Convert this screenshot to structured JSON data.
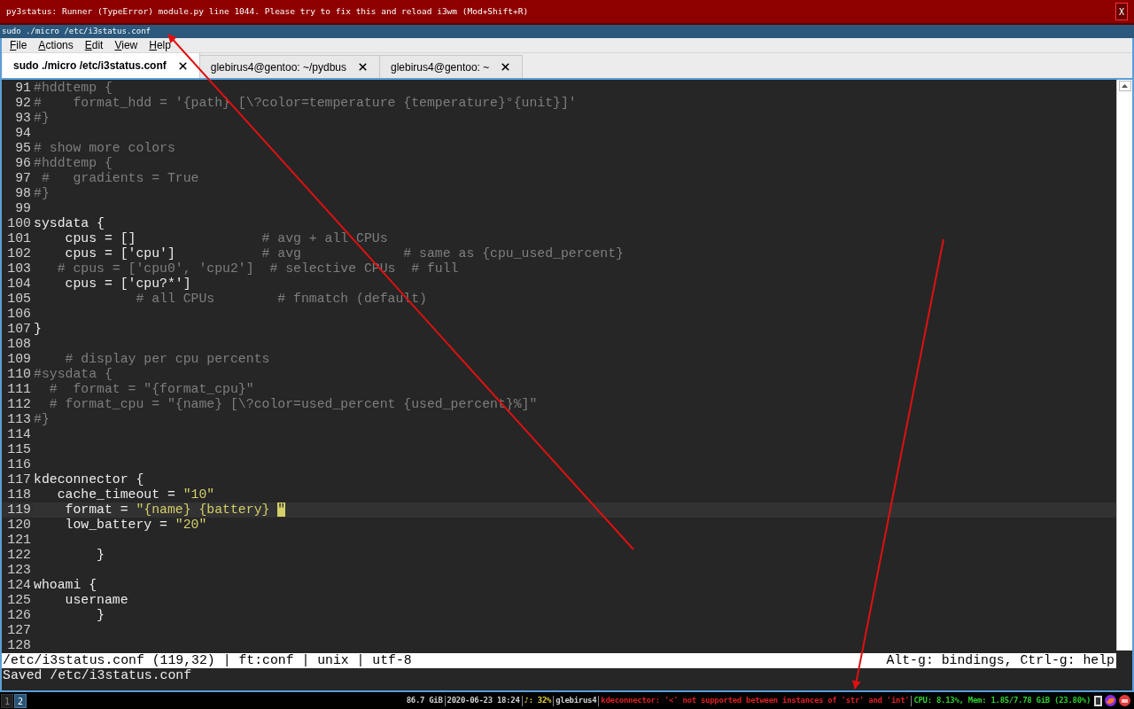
{
  "notification": {
    "message": "py3status: Runner (TypeError) module.py line 1044. Please try to fix this and reload i3wm (Mod+Shift+R)",
    "close": "X"
  },
  "window": {
    "title": "sudo ./micro /etc/i3status.conf"
  },
  "menu": [
    "File",
    "Actions",
    "Edit",
    "View",
    "Help"
  ],
  "tabs": [
    {
      "label": "sudo ./micro /etc/i3status.conf",
      "selected": true
    },
    {
      "label": "glebirus4@gentoo: ~/pydbus",
      "selected": false
    },
    {
      "label": "glebirus4@gentoo: ~",
      "selected": false
    }
  ],
  "editor": {
    "lines": [
      {
        "number": "91",
        "current": false,
        "segments": [
          {
            "kind": "comment",
            "text": "#hddtemp {"
          }
        ]
      },
      {
        "number": "92",
        "current": false,
        "segments": [
          {
            "kind": "comment",
            "text": "#    format_hdd = '{path} [\\?color=temperature {temperature}°{unit}]'"
          }
        ]
      },
      {
        "number": "93",
        "current": false,
        "segments": [
          {
            "kind": "comment",
            "text": "#}"
          }
        ]
      },
      {
        "number": "94",
        "current": false
      },
      {
        "number": "95",
        "current": false,
        "segments": [
          {
            "kind": "comment",
            "text": "# show more colors"
          }
        ]
      },
      {
        "number": "96",
        "current": false,
        "segments": [
          {
            "kind": "comment",
            "text": "#hddtemp {"
          }
        ]
      },
      {
        "number": "97",
        "current": false,
        "segments": [
          {
            "kind": "comment",
            "text": " #   gradients = True"
          }
        ]
      },
      {
        "number": "98",
        "current": false,
        "segments": [
          {
            "kind": "comment",
            "text": "#}"
          }
        ]
      },
      {
        "number": "99",
        "current": false
      },
      {
        "number": "100",
        "current": false,
        "segments": [
          {
            "kind": "code",
            "text": "sysdata {"
          }
        ]
      },
      {
        "number": "101",
        "current": false,
        "segments": [
          {
            "kind": "code",
            "text": "    cpus = []                "
          },
          {
            "kind": "comment",
            "text": "# avg + all CPUs"
          }
        ]
      },
      {
        "number": "102",
        "current": false,
        "segments": [
          {
            "kind": "code",
            "text": "    cpus = ['cpu']           "
          },
          {
            "kind": "comment",
            "text": "# avg             # same as {cpu_used_percent}"
          }
        ]
      },
      {
        "number": "103",
        "current": false,
        "segments": [
          {
            "kind": "comment",
            "text": "   # cpus = ['cpu0', 'cpu2']  # selective CPUs  # full"
          }
        ]
      },
      {
        "number": "104",
        "current": false,
        "segments": [
          {
            "kind": "code",
            "text": "    cpus = ['cpu?*']"
          }
        ]
      },
      {
        "number": "105",
        "current": false,
        "segments": [
          {
            "kind": "comment",
            "text": "             # all CPUs        # fnmatch (default)"
          }
        ]
      },
      {
        "number": "106",
        "current": false
      },
      {
        "number": "107",
        "current": false,
        "segments": [
          {
            "kind": "code",
            "text": "}"
          }
        ]
      },
      {
        "number": "108",
        "current": false
      },
      {
        "number": "109",
        "current": false,
        "segments": [
          {
            "kind": "comment",
            "text": "    # display per cpu percents"
          }
        ]
      },
      {
        "number": "110",
        "current": false,
        "segments": [
          {
            "kind": "comment",
            "text": "#sysdata {"
          }
        ]
      },
      {
        "number": "111",
        "current": false,
        "segments": [
          {
            "kind": "comment",
            "text": "  #  format = \"{format_cpu}\""
          }
        ]
      },
      {
        "number": "112",
        "current": false,
        "segments": [
          {
            "kind": "comment",
            "text": "  # format_cpu = \"{name} [\\?color=used_percent {used_percent}%]\""
          }
        ]
      },
      {
        "number": "113",
        "current": false,
        "segments": [
          {
            "kind": "comment",
            "text": "#}"
          }
        ]
      },
      {
        "number": "114",
        "current": false
      },
      {
        "number": "115",
        "current": false
      },
      {
        "number": "116",
        "current": false
      },
      {
        "number": "117",
        "current": false,
        "segments": [
          {
            "kind": "code",
            "text": "kdeconnector {"
          }
        ]
      },
      {
        "number": "118",
        "current": false,
        "segments": [
          {
            "kind": "code",
            "text": "   cache_timeout = "
          },
          {
            "kind": "string",
            "text": "\"10\""
          }
        ]
      },
      {
        "number": "119",
        "current": true,
        "segments": [
          {
            "kind": "code",
            "text": "    format = "
          },
          {
            "kind": "string",
            "text": "\"{name} {battery} "
          },
          {
            "kind": "cursor",
            "text": "\""
          }
        ]
      },
      {
        "number": "120",
        "current": false,
        "segments": [
          {
            "kind": "code",
            "text": "    low_battery = "
          },
          {
            "kind": "string",
            "text": "\"20\""
          }
        ]
      },
      {
        "number": "121",
        "current": false
      },
      {
        "number": "122",
        "current": false,
        "segments": [
          {
            "kind": "code",
            "text": "        }"
          }
        ]
      },
      {
        "number": "123",
        "current": false
      },
      {
        "number": "124",
        "current": false,
        "segments": [
          {
            "kind": "code",
            "text": "whoami {"
          }
        ]
      },
      {
        "number": "125",
        "current": false,
        "segments": [
          {
            "kind": "code",
            "text": "    username"
          }
        ]
      },
      {
        "number": "126",
        "current": false,
        "segments": [
          {
            "kind": "code",
            "text": "        }"
          }
        ]
      },
      {
        "number": "127",
        "current": false
      },
      {
        "number": "128",
        "current": false
      }
    ],
    "status_line": {
      "left": "/etc/i3status.conf (119,32) | ft:conf | unix | utf-8",
      "right": "Alt-g: bindings, Ctrl-g: help"
    },
    "message": "Saved /etc/i3status.conf"
  },
  "bar": {
    "workspaces": [
      {
        "label": "1",
        "selected": false
      },
      {
        "label": "2",
        "selected": true
      }
    ],
    "status": [
      {
        "text": "86.7 GiB",
        "color": "#d0d0d0"
      },
      {
        "text": "2020-06-23 18:24",
        "color": "#d0d0d0"
      },
      {
        "text": "♪: 32%",
        "color": "#e6d23c"
      },
      {
        "text": "glebirus4",
        "color": "#d0d0d0"
      },
      {
        "text": "kdeconnector: '<' not supported between instances of 'str' and 'int'",
        "color": "#e02020"
      },
      {
        "text": "CPU: 8.13%, Mem: 1.85/7.78 GiB (23.80%)",
        "color": "#30d030"
      }
    ]
  }
}
